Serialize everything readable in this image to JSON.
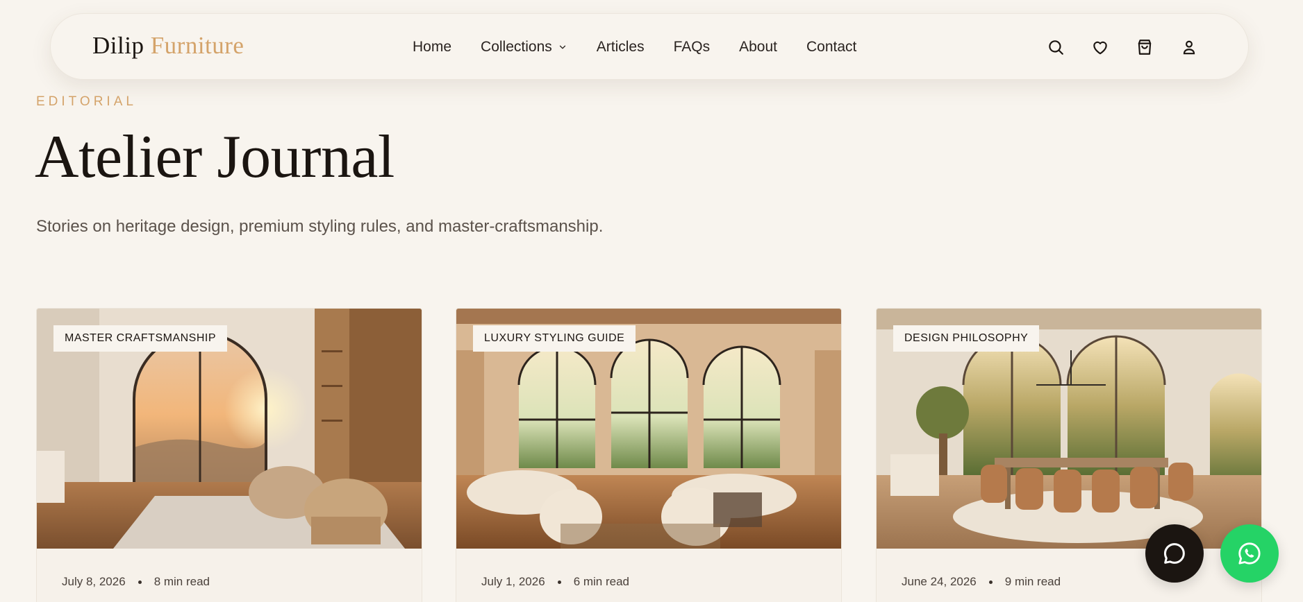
{
  "brand": {
    "name_part1": "Dilip",
    "name_part2": "Furniture",
    "accent_color": "#d4a36a"
  },
  "nav": {
    "items": [
      {
        "label": "Home"
      },
      {
        "label": "Collections",
        "has_dropdown": true
      },
      {
        "label": "Articles"
      },
      {
        "label": "FAQs"
      },
      {
        "label": "About"
      },
      {
        "label": "Contact"
      }
    ]
  },
  "header_icons": [
    "search-icon",
    "heart-icon",
    "bag-icon",
    "user-icon"
  ],
  "hero": {
    "eyebrow": "EDITORIAL",
    "title": "Atelier Journal",
    "subtitle": "Stories on heritage design, premium styling rules, and master-craftsmanship."
  },
  "articles": [
    {
      "tag": "MASTER CRAFTSMANSHIP",
      "date": "July 8, 2026",
      "read_time": "8 min read"
    },
    {
      "tag": "LUXURY STYLING GUIDE",
      "date": "July 1, 2026",
      "read_time": "6 min read"
    },
    {
      "tag": "DESIGN PHILOSOPHY",
      "date": "June 24, 2026",
      "read_time": "9 min read"
    }
  ],
  "floating": {
    "chat_icon": "chat-bubble-icon",
    "whatsapp_icon": "whatsapp-icon",
    "whatsapp_color": "#25d366"
  }
}
